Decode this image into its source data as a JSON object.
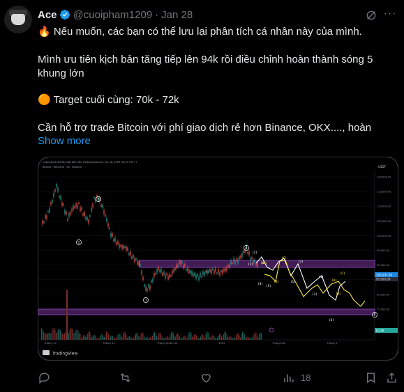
{
  "author": {
    "name": "Ace",
    "handle": "@cuoipham1209",
    "separator": "·",
    "date": "Jan 28"
  },
  "tweet": {
    "line1": "🔥 Nếu muốn, các bạn có thể lưu lại phân tích cá nhân này của mình.",
    "line2": "Mình ưu tiên kịch bản tăng tiếp lên 94k rồi điều chỉnh hoàn thành sóng 5",
    "line3": "khung lớn",
    "line4": "🟠 Target cuối cùng: 70k - 72k",
    "line5": "Cần hỗ trợ trade Bitcoin với phí giao dịch rẻ hơn Binance, OKX...., hoàn",
    "show_more": "Show more"
  },
  "chart_header": {
    "top_line": "cuoipham1209 đã xuất bản trên TradingView.com, Jan 28, 2025 08:13 UTC+7",
    "symbol_line": "Bitcoin / TetherUS · 4h · Binance",
    "currency": "USDT",
    "watermark": "TradingView"
  },
  "chart_axis": {
    "y_ticks": [
      "120,000.00",
      "115,000.00",
      "110,000.00",
      "105,000.00",
      "100,000.00",
      "95,000.00",
      "90,000.00",
      "85,000.00",
      "80,000.00",
      "75,000.00"
    ],
    "x_ticks": [
      "Tháng 10",
      "Tháng 11",
      "Tháng Mười hai",
      "2025",
      "Tháng Hai",
      "Tháng 3"
    ],
    "price_tag": "100,247.56",
    "price_tag2": "97,000.00",
    "bottom_tag": "8,236"
  },
  "chart_data": {
    "type": "line",
    "wave_labels_white": [
      "1",
      "2",
      "3",
      "4",
      "5",
      "1",
      "2",
      "3",
      "4",
      "5"
    ],
    "wave_labels_yellow": [
      "A",
      "B",
      "C",
      "A",
      "B",
      "C"
    ],
    "wave_labels_small": [
      "(1)",
      "(2)",
      "(3)",
      "(4)",
      "(5)",
      "(1)",
      "(2)",
      "(3)",
      "(4)",
      "(5)",
      "(A)",
      "(B)",
      "(C)",
      "(A)",
      "(B)",
      "(C)"
    ],
    "price_path": [
      [
        0,
        100
      ],
      [
        10,
        108
      ],
      [
        18,
        106
      ],
      [
        25,
        122
      ],
      [
        32,
        118
      ],
      [
        40,
        125
      ],
      [
        48,
        115
      ],
      [
        56,
        109
      ],
      [
        62,
        112
      ],
      [
        70,
        104
      ],
      [
        78,
        101
      ],
      [
        86,
        96
      ],
      [
        94,
        92
      ],
      [
        100,
        95
      ],
      [
        108,
        93
      ]
    ],
    "projection_path": [
      [
        0,
        0
      ],
      [
        1,
        1
      ]
    ]
  },
  "actions": {
    "reply_count": "",
    "retweet_count": "",
    "like_count": "",
    "views_count": "18"
  }
}
